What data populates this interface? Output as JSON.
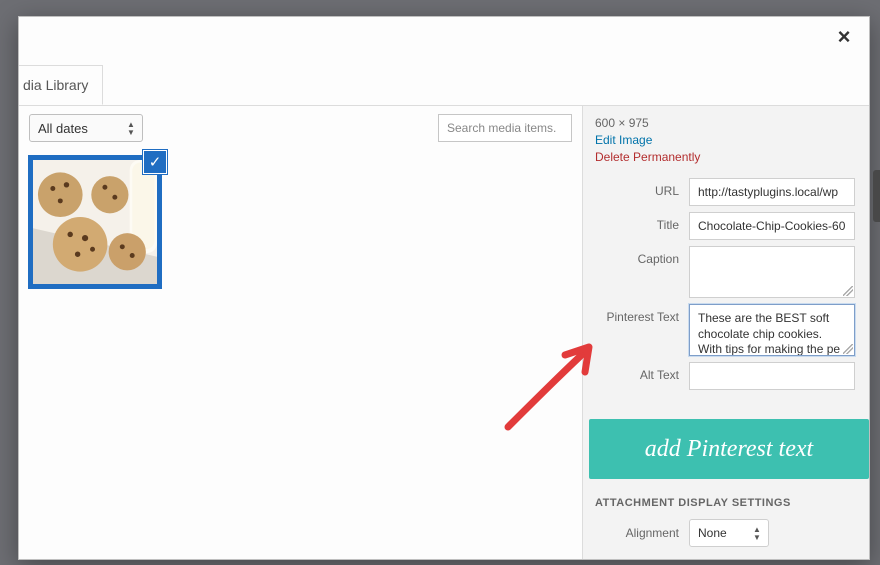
{
  "tab": {
    "label": "dia Library"
  },
  "filter": {
    "all_dates": "All dates"
  },
  "search": {
    "placeholder": "Search media items."
  },
  "dimensions": "600 × 975",
  "links": {
    "edit": "Edit Image",
    "delete": "Delete Permanently"
  },
  "form": {
    "url_label": "URL",
    "url_value": "http://tastyplugins.local/wp",
    "title_label": "Title",
    "title_value": "Chocolate-Chip-Cookies-60",
    "caption_label": "Caption",
    "caption_value": "",
    "pinterest_label": "Pinterest Text",
    "pinterest_value": "These are the BEST soft chocolate chip cookies. With tips for making the pe",
    "alttext_label": "Alt Text",
    "alttext_value": ""
  },
  "callout": "add Pinterest text",
  "attachment_settings_label": "ATTACHMENT DISPLAY SETTINGS",
  "alignment": {
    "label": "Alignment",
    "value": "None"
  }
}
